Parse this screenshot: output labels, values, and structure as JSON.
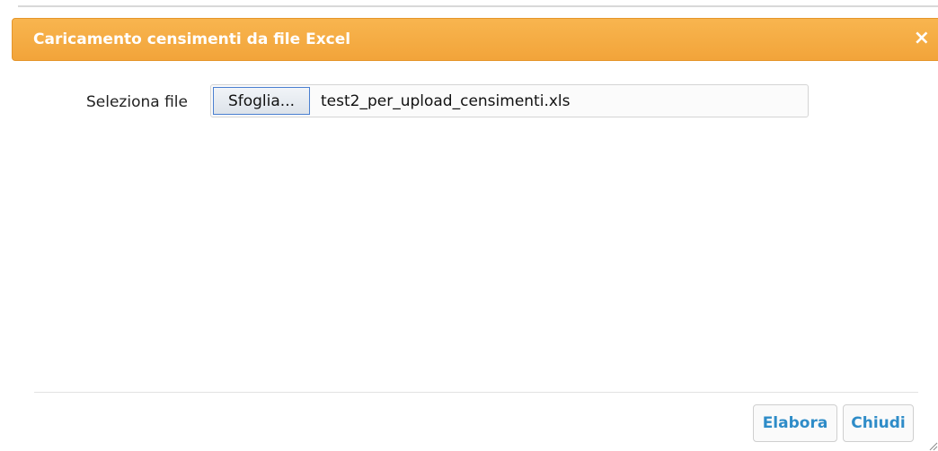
{
  "dialog": {
    "title": "Caricamento censimenti da file Excel",
    "close_icon": "close-icon",
    "colors": {
      "titlebar": "#f2a43a",
      "button_text": "#2e8cc8"
    }
  },
  "file_input": {
    "label": "Seleziona file",
    "browse_label": "Sfoglia...",
    "selected_file": "test2_per_upload_censimenti.xls"
  },
  "footer": {
    "elabora_label": "Elabora",
    "chiudi_label": "Chiudi"
  }
}
